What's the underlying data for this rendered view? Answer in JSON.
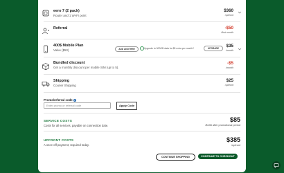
{
  "items": [
    {
      "title": "eero 7 (2 pack)",
      "subtitle": "Router and 1 Wi-Fi point",
      "amount": "$360",
      "period": "/upfront"
    },
    {
      "title": "Referral",
      "subtitle": "",
      "amount": "-$50",
      "period": "/first month"
    },
    {
      "title": "400$ Mobile Plan",
      "subtitle": "Value ($50)",
      "amount": "$35",
      "period": "/month",
      "add_another": "ADD ANOTHER",
      "upgrade_text": "Upgrade to 500GB data for $5 extra per month?",
      "upgrade_button": "UPGRADE"
    },
    {
      "title": "Bundled discount",
      "subtitle": "Get a monthly discount per mobile SIM (up to 5).",
      "amount": "-$5",
      "period": "/month"
    },
    {
      "title": "Shipping",
      "subtitle": "Courier Shipping",
      "amount": "$25",
      "period": "/upfront"
    }
  ],
  "promo": {
    "label": "Promo/referral code",
    "placeholder": "Enter promo or referral code",
    "apply": "Apply Code"
  },
  "service_costs": {
    "label": "SERVICE COSTS",
    "subtitle": "Costs for all services, payable on connection date.",
    "amount": "$85",
    "note": "/$135 after promotional period"
  },
  "upfront_costs": {
    "label": "UPFRONT COSTS",
    "subtitle": "A once-off payment, required today.",
    "amount": "$385",
    "note": "/upfront"
  },
  "buttons": {
    "continue_shopping": "CONTINUE SHOPPING",
    "checkout": "CONTINUE TO CHECKOUT"
  },
  "colors": {
    "brand_green": "#0b5a2a",
    "discount_red": "#d23a2a"
  }
}
